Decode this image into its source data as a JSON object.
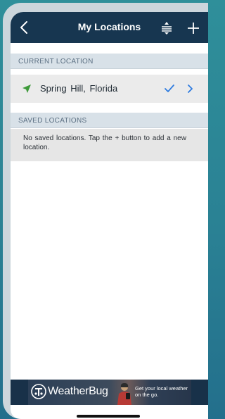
{
  "navbar": {
    "title": "My Locations",
    "back_icon": "chevron-left-icon",
    "sort_icon": "reorder-icon",
    "add_icon": "plus-icon"
  },
  "current_section": {
    "header": "CURRENT LOCATION",
    "location_name": "Spring Hill, Florida",
    "selected": true
  },
  "saved_section": {
    "header": "SAVED LOCATIONS",
    "empty_message": "No saved locations. Tap the + button to add a new location."
  },
  "ad": {
    "brand": "WeatherBug",
    "tagline": "Get your local weather on the go."
  },
  "colors": {
    "navbar": "#173650",
    "section_header": "#d8e1e8",
    "accent_blue": "#2f7ce0",
    "arrow_green": "#3e9a3a"
  }
}
